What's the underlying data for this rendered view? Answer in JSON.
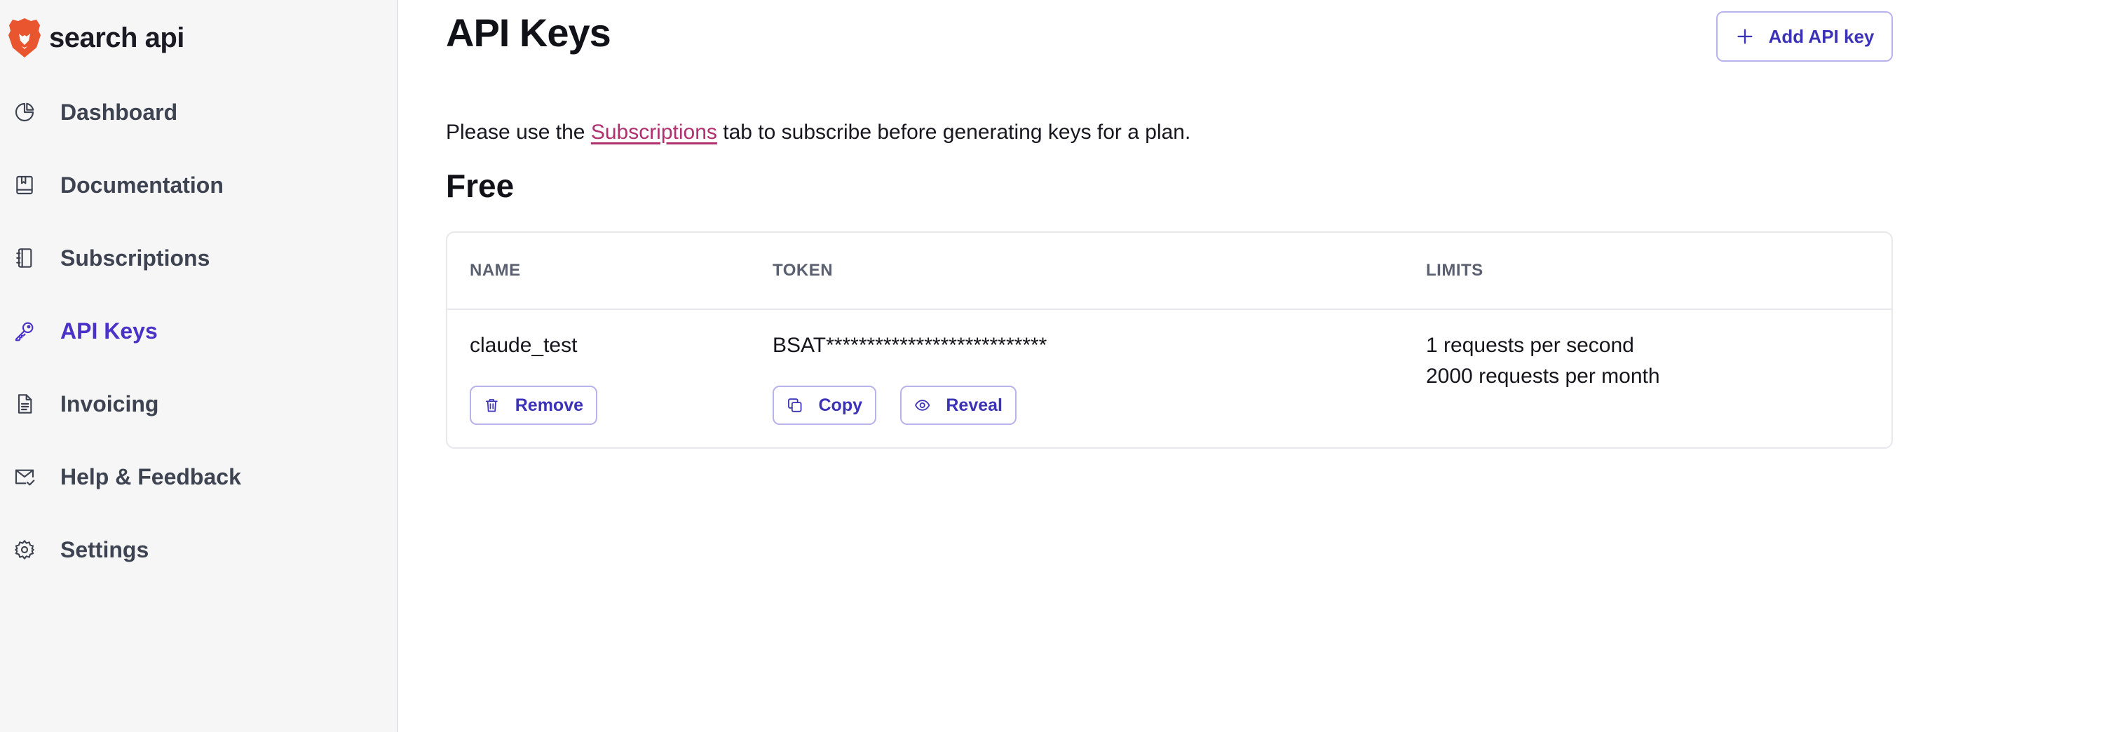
{
  "brand": {
    "name": "search api",
    "colors": {
      "accent": "#4a32c8",
      "logo": "#e8552f",
      "link": "#b02f6e"
    }
  },
  "sidebar": {
    "items": [
      {
        "label": "Dashboard",
        "icon": "pie-chart-icon",
        "active": false
      },
      {
        "label": "Documentation",
        "icon": "book-icon",
        "active": false
      },
      {
        "label": "Subscriptions",
        "icon": "notebook-icon",
        "active": false
      },
      {
        "label": "API Keys",
        "icon": "key-icon",
        "active": true
      },
      {
        "label": "Invoicing",
        "icon": "document-icon",
        "active": false
      },
      {
        "label": "Help & Feedback",
        "icon": "mail-check-icon",
        "active": false
      },
      {
        "label": "Settings",
        "icon": "gear-icon",
        "active": false
      }
    ]
  },
  "main": {
    "title": "API Keys",
    "add_button": "Add API key",
    "notice": {
      "before": "Please use the ",
      "link": "Subscriptions",
      "after": " tab to subscribe before generating keys for a plan."
    },
    "plan": {
      "name": "Free",
      "columns": [
        "NAME",
        "TOKEN",
        "LIMITS"
      ],
      "keys": [
        {
          "name": "claude_test",
          "token": "BSAT***************************",
          "limits": [
            "1 requests per second",
            "2000 requests per month"
          ],
          "actions": {
            "remove": "Remove",
            "copy": "Copy",
            "reveal": "Reveal"
          }
        }
      ]
    }
  }
}
